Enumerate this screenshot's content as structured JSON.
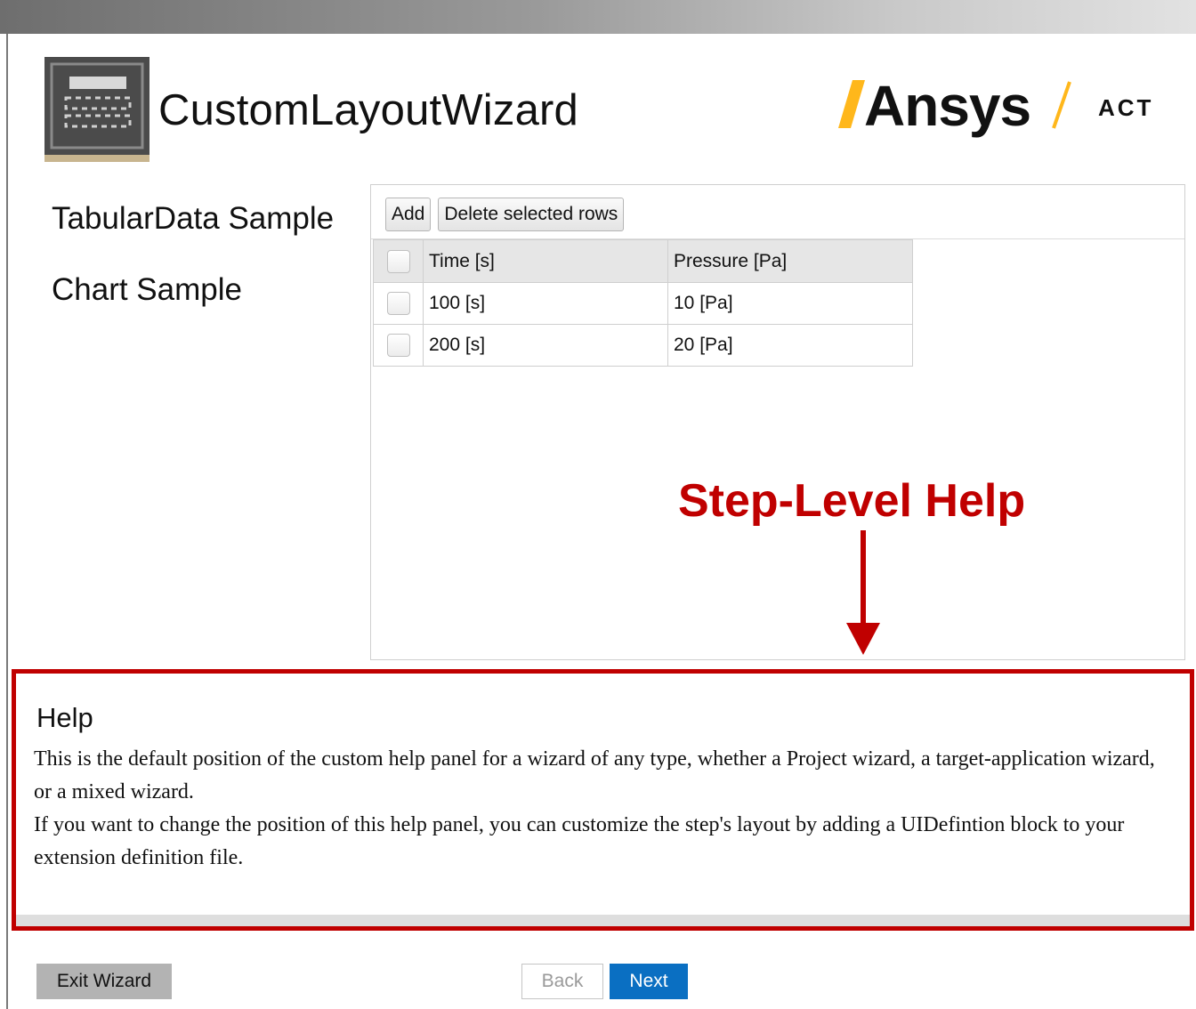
{
  "header": {
    "app_title": "CustomLayoutWizard",
    "app_icon": "calculator-icon",
    "brand": {
      "name": "Ansys",
      "product": "ACT",
      "accent_color": "#ffb71b"
    }
  },
  "steps": [
    {
      "label": "TabularData Sample"
    },
    {
      "label": "Chart Sample"
    }
  ],
  "table": {
    "toolbar": {
      "add_label": "Add",
      "delete_label": "Delete selected rows"
    },
    "columns": [
      "Time [s]",
      "Pressure [Pa]"
    ],
    "rows": [
      {
        "time": "100 [s]",
        "pressure": "10 [Pa]",
        "selected": false
      },
      {
        "time": "200 [s]",
        "pressure": "20 [Pa]",
        "selected": false
      }
    ]
  },
  "annotation": {
    "text": "Step-Level Help",
    "color": "#c00000"
  },
  "help": {
    "title": "Help",
    "paragraphs": [
      "This is the default position of the custom help panel for a wizard of any type, whether a Project wizard, a target-application wizard, or a mixed wizard.",
      "If you want to change the position of this help panel, you can customize the step's layout by adding a UIDefintion block to your extension definition file."
    ]
  },
  "footer": {
    "exit_label": "Exit Wizard",
    "back_label": "Back",
    "next_label": "Next",
    "next_color": "#0a6fc2"
  }
}
